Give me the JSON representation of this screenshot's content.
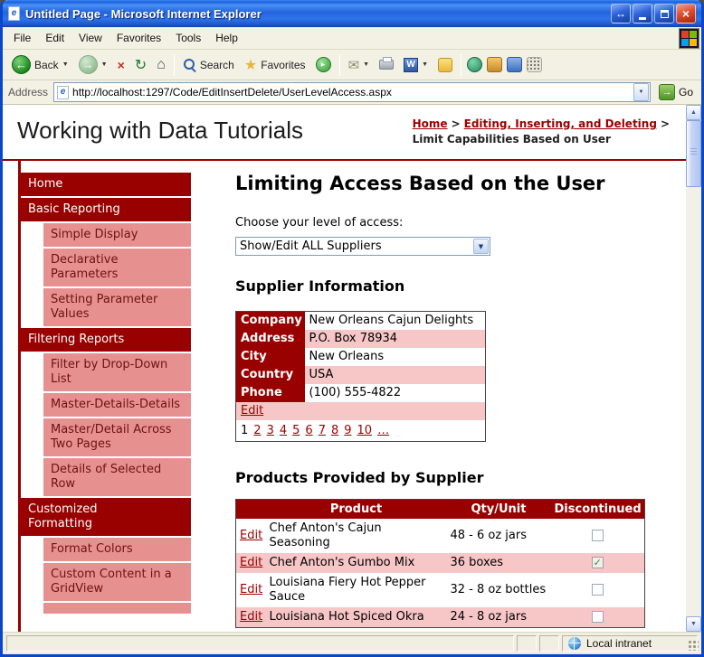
{
  "colors": {
    "maroon": "#990000",
    "sidebar_pink": "#E79090",
    "row_pink": "#F7C6C6",
    "titlebar_blue": "#2465DE",
    "chrome_tan": "#F3F1E4",
    "link_maroon": "#990000"
  },
  "icons": {
    "title_resize": "↔",
    "close": "×",
    "back_arrow": "←",
    "forward_arrow": "→",
    "stop": "×",
    "refresh": "↻",
    "home": "⌂",
    "favorites_star": "★",
    "media_play": "▸",
    "mail": "✉",
    "word": "W",
    "dropdown": "▼",
    "go_arrow": "→",
    "page_e": "e",
    "up": "▲",
    "down": "▼",
    "check": "✓"
  },
  "window": {
    "title": "Untitled Page - Microsoft Internet Explorer"
  },
  "menu_bar": {
    "items": [
      "File",
      "Edit",
      "View",
      "Favorites",
      "Tools",
      "Help"
    ]
  },
  "toolbar": {
    "back_label": "Back",
    "search_label": "Search",
    "favorites_label": "Favorites"
  },
  "address_bar": {
    "label": "Address",
    "url": "http://localhost:1297/Code/EditInsertDelete/UserLevelAccess.aspx",
    "go_label": "Go"
  },
  "masthead": {
    "site_title": "Working with Data Tutorials",
    "breadcrumb": {
      "link1": "Home",
      "sep1": ">",
      "link2": "Editing, Inserting, and Deleting",
      "sep2": ">",
      "current": "Limit Capabilities Based on User"
    }
  },
  "sidebar": {
    "items": [
      {
        "label": "Home",
        "type": "section"
      },
      {
        "label": "Basic Reporting",
        "type": "section"
      },
      {
        "label": "Simple Display",
        "type": "link"
      },
      {
        "label": "Declarative Parameters",
        "type": "link"
      },
      {
        "label": "Setting Parameter Values",
        "type": "link"
      },
      {
        "label": "Filtering Reports",
        "type": "section"
      },
      {
        "label": "Filter by Drop-Down List",
        "type": "link"
      },
      {
        "label": "Master-Details-Details",
        "type": "link"
      },
      {
        "label": "Master/Detail Across Two Pages",
        "type": "link"
      },
      {
        "label": "Details of Selected Row",
        "type": "link"
      },
      {
        "label": "Customized Formatting",
        "type": "section"
      },
      {
        "label": "Format Colors",
        "type": "link"
      },
      {
        "label": "Custom Content in a GridView",
        "type": "link"
      }
    ]
  },
  "content": {
    "page_title": "Limiting Access Based on the User",
    "access_label": "Choose your level of access:",
    "access_dropdown_value": "Show/Edit ALL Suppliers",
    "supplier_section_title": "Supplier Information",
    "supplier_details": {
      "rows": [
        {
          "field": "Company",
          "value": "New Orleans Cajun Delights"
        },
        {
          "field": "Address",
          "value": "P.O. Box 78934"
        },
        {
          "field": "City",
          "value": "New Orleans"
        },
        {
          "field": "Country",
          "value": "USA"
        },
        {
          "field": "Phone",
          "value": "(100) 555-4822"
        }
      ],
      "edit_link": "Edit",
      "pager": {
        "current": "1",
        "pages": [
          "2",
          "3",
          "4",
          "5",
          "6",
          "7",
          "8",
          "9",
          "10"
        ],
        "ellipsis": "…"
      }
    },
    "products_section_title": "Products Provided by Supplier",
    "products_grid": {
      "headers": {
        "edit": "",
        "product": "Product",
        "qty": "Qty/Unit",
        "discontinued": "Discontinued"
      },
      "edit_link": "Edit",
      "rows": [
        {
          "product": "Chef Anton's Cajun Seasoning",
          "qty": "48 - 6 oz jars",
          "discontinued": false
        },
        {
          "product": "Chef Anton's Gumbo Mix",
          "qty": "36 boxes",
          "discontinued": true
        },
        {
          "product": "Louisiana Fiery Hot Pepper Sauce",
          "qty": "32 - 8 oz bottles",
          "discontinued": false
        },
        {
          "product": "Louisiana Hot Spiced Okra",
          "qty": "24 - 8 oz jars",
          "discontinued": false
        }
      ]
    }
  },
  "status_bar": {
    "zone": "Local intranet"
  }
}
